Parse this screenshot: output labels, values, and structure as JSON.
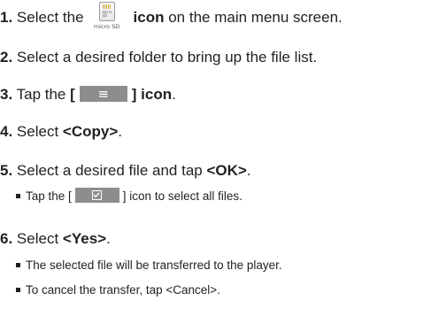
{
  "steps": [
    {
      "number": "1.",
      "pre": "Select the",
      "icon": "micro-sd-card-icon",
      "icon_caption": "micro SD",
      "bold": "icon",
      "post": "on the main menu screen."
    },
    {
      "number": "2.",
      "text": "Select a desired folder to bring up the file list."
    },
    {
      "number": "3.",
      "pre": "Tap the",
      "bracket_open": "[",
      "icon": "hamburger-menu-icon",
      "icon_glyph": "≡",
      "bracket_close": "] icon",
      "end": "."
    },
    {
      "number": "4.",
      "pre": "Select",
      "bold": "<Copy>",
      "end": "."
    },
    {
      "number": "5.",
      "pre": "Select a desired file and tap",
      "bold": "<OK>",
      "end": ".",
      "note": {
        "pre": "Tap the [",
        "icon": "select-all-checkbox-icon",
        "post": "] icon to select all files."
      }
    },
    {
      "number": "6.",
      "pre": "Select",
      "bold": "<Yes>",
      "end": ".",
      "notes": [
        "The selected file will be transferred to the player.",
        "To cancel the transfer, tap <Cancel>."
      ]
    }
  ],
  "colors": {
    "text": "#231f20",
    "button_box": "#8c8d8f"
  }
}
